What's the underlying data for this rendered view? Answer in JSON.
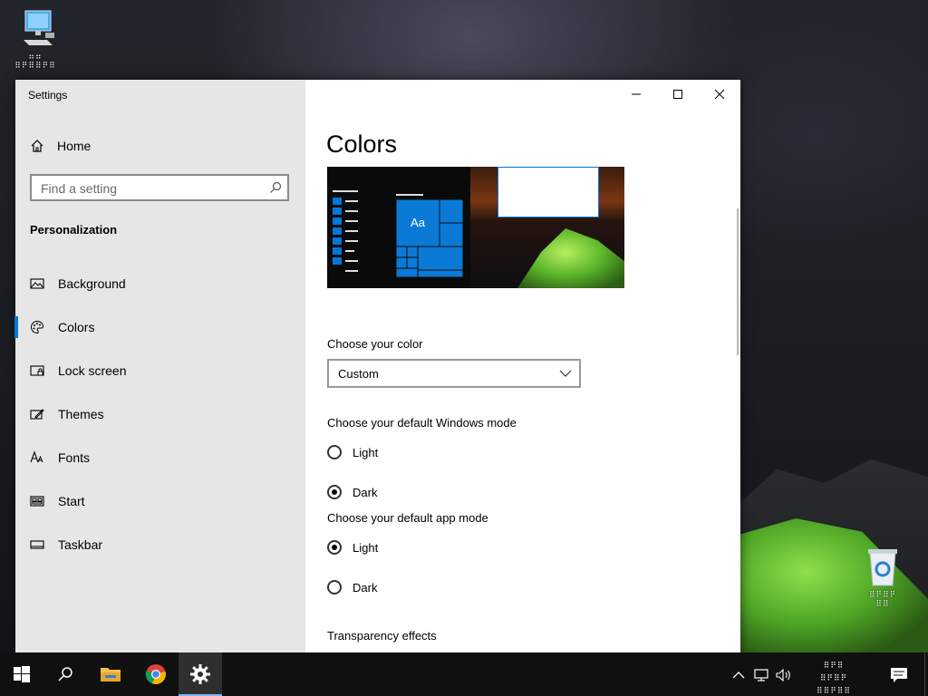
{
  "desktop": {
    "this_pc_label": "⠶⠶\n⠿⠟⠿⠿⠟⠿",
    "recycle_label": "⠿⠟⠿⠟\n⠿⠿"
  },
  "window": {
    "app_title": "Settings",
    "home_label": "Home",
    "search_placeholder": "Find a setting",
    "section_label": "Personalization",
    "nav": [
      {
        "label": "Background",
        "icon": "image-icon"
      },
      {
        "label": "Colors",
        "icon": "palette-icon"
      },
      {
        "label": "Lock screen",
        "icon": "lock-screen-icon"
      },
      {
        "label": "Themes",
        "icon": "themes-icon"
      },
      {
        "label": "Fonts",
        "icon": "fonts-icon"
      },
      {
        "label": "Start",
        "icon": "start-icon"
      },
      {
        "label": "Taskbar",
        "icon": "taskbar-icon"
      }
    ],
    "selected_nav": "Colors",
    "accent_color": "#0078d7"
  },
  "content": {
    "title": "Colors",
    "preview_sample": "Aa",
    "choose_color_label": "Choose your color",
    "color_value": "Custom",
    "windows_mode_label": "Choose your default Windows mode",
    "windows_mode_options": [
      "Light",
      "Dark"
    ],
    "windows_mode_selected": "Dark",
    "app_mode_label": "Choose your default app mode",
    "app_mode_options": [
      "Light",
      "Dark"
    ],
    "app_mode_selected": "Light",
    "transparency_label": "Transparency effects"
  },
  "taskbar": {
    "clock_text": "⠿⠟⠿\n⠿⠟⠿⠟\n⠿⠿⠟⠿⠿"
  }
}
